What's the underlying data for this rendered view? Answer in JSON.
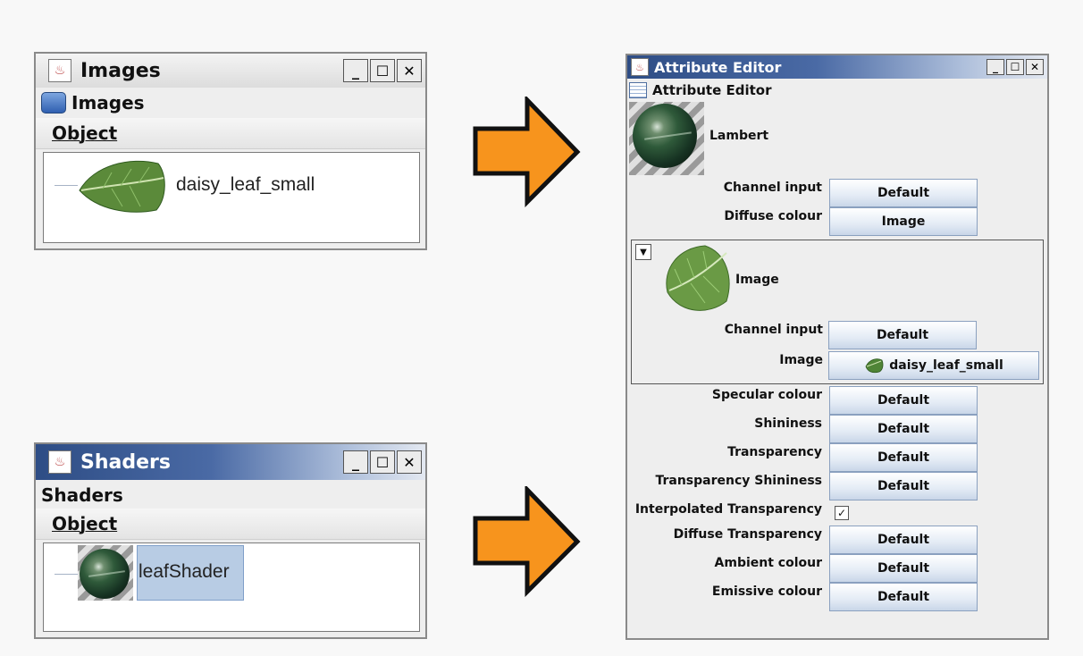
{
  "images_window": {
    "title": "Images",
    "menu_title": "Images",
    "menu_object": "Object",
    "items": [
      {
        "label": "daisy_leaf_small",
        "icon": "leaf-thumbnail"
      }
    ]
  },
  "shaders_window": {
    "title": "Shaders",
    "menu_title": "Shaders",
    "menu_object": "Object",
    "items": [
      {
        "label": "leafShader",
        "icon": "sphere-thumbnail"
      }
    ]
  },
  "window_controls": {
    "minimize": "_",
    "maximize": "☐",
    "close": "✕"
  },
  "attribute_editor": {
    "title": "Attribute Editor",
    "menu_title": "Attribute Editor",
    "shader_type": "Lambert",
    "rows_top": [
      {
        "label": "Channel input",
        "value": "Default"
      },
      {
        "label": "Diffuse colour",
        "value": "Image"
      }
    ],
    "image_section": {
      "collapse_icon": "▼",
      "title": "Image",
      "rows": [
        {
          "label": "Channel input",
          "value": "Default"
        },
        {
          "label": "Image",
          "value": "daisy_leaf_small"
        }
      ]
    },
    "rows_bottom": [
      {
        "label": "Specular colour",
        "value": "Default"
      },
      {
        "label": "Shininess",
        "value": "Default"
      },
      {
        "label": "Transparency",
        "value": "Default"
      },
      {
        "label": "Transparency Shininess",
        "value": "Default"
      }
    ],
    "interpolated_label": "Interpolated Transparency",
    "interpolated_checked": true,
    "rows_end": [
      {
        "label": "Diffuse Transparency",
        "value": "Default"
      },
      {
        "label": "Ambient colour",
        "value": "Default"
      },
      {
        "label": "Emissive colour",
        "value": "Default"
      }
    ]
  },
  "colors": {
    "arrow_fill": "#f7941d",
    "arrow_stroke": "#111111",
    "title_active": "#2e4d85",
    "selection": "#b8cce4"
  }
}
